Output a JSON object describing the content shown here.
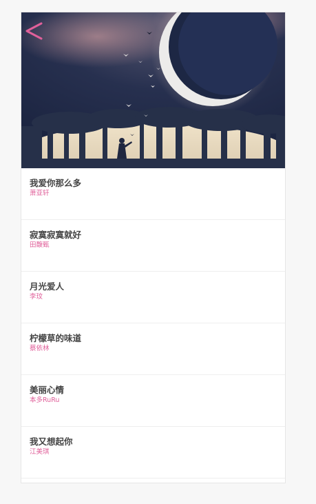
{
  "header": {
    "back_icon": "chevron-left-icon",
    "accent_color": "#e0609a"
  },
  "hero": {
    "image": "moon-night-forest-girl-birds"
  },
  "songs": [
    {
      "title": "我爱你那么多",
      "artist": "萧亚轩"
    },
    {
      "title": "寂寞寂寞就好",
      "artist": "田馥甄"
    },
    {
      "title": "月光爱人",
      "artist": "李玟"
    },
    {
      "title": "柠檬草的味道",
      "artist": "蔡依林"
    },
    {
      "title": "美丽心情",
      "artist": "本多RuRu"
    },
    {
      "title": "我又想起你",
      "artist": "江美琪"
    }
  ]
}
